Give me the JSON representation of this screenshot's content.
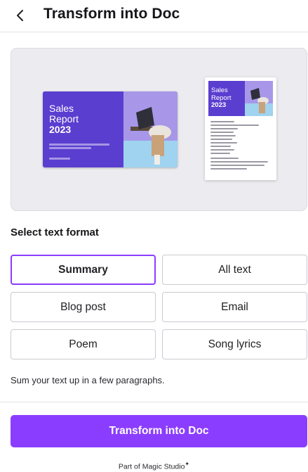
{
  "header": {
    "title": "Transform into Doc",
    "back_icon": "chevron-left-icon"
  },
  "preview": {
    "presentation": {
      "title_line1": "Sales",
      "title_line2": "Report",
      "year": "2023"
    },
    "document": {
      "title_line1": "Sales",
      "title_line2": "Report",
      "year": "2023"
    }
  },
  "format": {
    "label": "Select text format",
    "selected": "Summary",
    "options": [
      {
        "label": "Summary"
      },
      {
        "label": "All text"
      },
      {
        "label": "Blog post"
      },
      {
        "label": "Email"
      },
      {
        "label": "Poem"
      },
      {
        "label": "Song lyrics"
      }
    ],
    "description": "Sum your text up in a few paragraphs."
  },
  "actions": {
    "primary_label": "Transform into Doc"
  },
  "footer": {
    "text": "Part of Magic Studio",
    "mark": "✦"
  },
  "colors": {
    "accent": "#8b3dff",
    "hero_purple": "#5a3ecf"
  }
}
